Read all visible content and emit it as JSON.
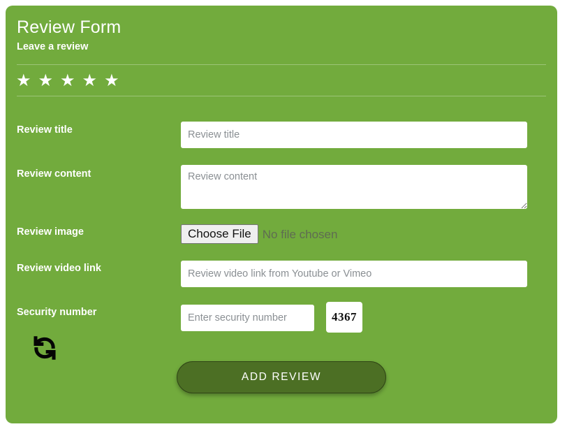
{
  "card": {
    "background_color": "#72ab3d",
    "title": "Review Form",
    "subtitle": "Leave a review"
  },
  "rating": {
    "star_glyph": "★",
    "star_count": 5,
    "stars": [
      {
        "name": "star-1",
        "glyph": "★"
      },
      {
        "name": "star-2",
        "glyph": "★"
      },
      {
        "name": "star-3",
        "glyph": "★"
      },
      {
        "name": "star-4",
        "glyph": "★"
      },
      {
        "name": "star-5",
        "glyph": "★"
      }
    ]
  },
  "fields": {
    "review_title": {
      "label": "Review title",
      "placeholder": "Review title",
      "value": ""
    },
    "review_content": {
      "label": "Review content",
      "placeholder": "Review content",
      "value": ""
    },
    "review_image": {
      "label": "Review image",
      "button_label": "Choose File",
      "status_text": "No file chosen"
    },
    "review_video_link": {
      "label": "Review video link",
      "placeholder": "Review video link from Youtube or Vimeo",
      "value": ""
    },
    "security_number": {
      "label": "Security number",
      "placeholder": "Enter security number",
      "value": "",
      "captcha_code": "4367",
      "refresh_icon": "refresh-icon"
    }
  },
  "submit": {
    "label": "ADD REVIEW",
    "color": "#4c6f24"
  }
}
